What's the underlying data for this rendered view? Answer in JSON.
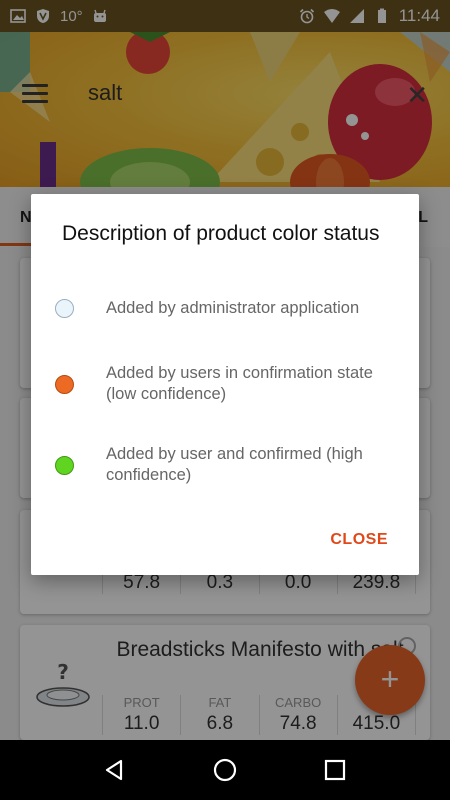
{
  "status_bar": {
    "temperature": "10°",
    "time": "11:44"
  },
  "search": {
    "query": "salt"
  },
  "tabs": {
    "left_partial": "N",
    "right_partial": "L"
  },
  "cards": [
    {
      "title": "",
      "values": [
        "57.8",
        "0.3",
        "0.0",
        "239.8"
      ]
    },
    {
      "title": "Breadsticks Manifesto with salt",
      "labels": [
        "PROT",
        "FAT",
        "CARBO",
        ""
      ],
      "values": [
        "11.0",
        "6.8",
        "74.8",
        "415.0"
      ]
    }
  ],
  "fab": {
    "icon": "+"
  },
  "dialog": {
    "title": "Description of product color status",
    "items": [
      {
        "color": "#eaf4fb",
        "border": "#9aaec0",
        "text": "Added by administrator application"
      },
      {
        "color": "#ec6a23",
        "border": "#b54a10",
        "text": "Added by users in confirmation state (low confidence)"
      },
      {
        "color": "#5fd421",
        "border": "#3f9a12",
        "text": "Added by user and confirmed (high confidence)"
      }
    ],
    "close_label": "CLOSE"
  },
  "colors": {
    "accent": "#e0481a",
    "fab": "#e8642a"
  }
}
